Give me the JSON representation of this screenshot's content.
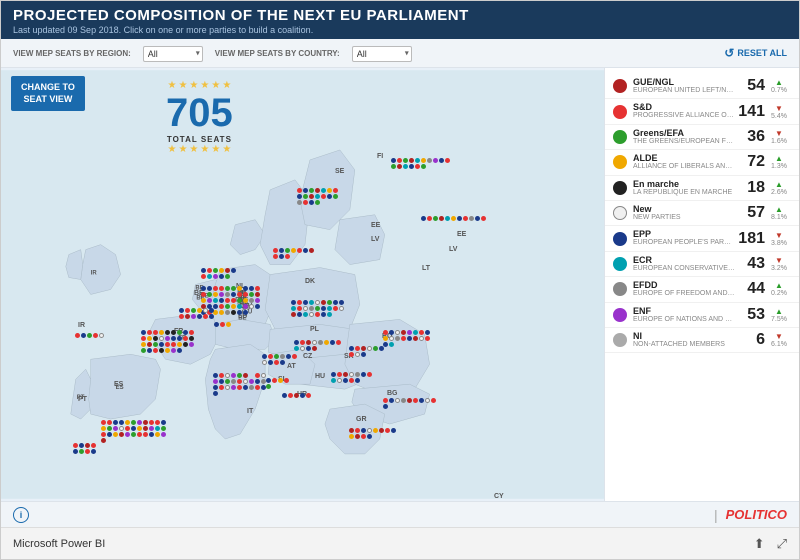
{
  "header": {
    "title": "PROJECTED COMPOSITION OF THE NEXT EU PARLIAMENT",
    "subtitle": "Last updated 09 Sep 2018. Click on one or more parties to build a coalition."
  },
  "toolbar": {
    "region_label": "VIEW MEP SEATS BY REGION:",
    "country_label": "VIEW MEP SEATS BY COUNTRY:",
    "region_value": "All",
    "country_value": "All",
    "reset_label": "RESET ALL"
  },
  "map": {
    "change_to_seat_view_line1": "CHANGE TO",
    "change_to_seat_view_line2": "SEAT VIEW",
    "total_seats_number": "705",
    "total_seats_label": "TOTAL SEATS"
  },
  "parties": [
    {
      "id": "GUE_NGL",
      "name": "GUE/NGL",
      "fullname": "EUROPEAN UNITED LEFT/NORDIC GREEN LEFT",
      "seats": 54,
      "pct": "0.7%",
      "trend": "up",
      "color": "#b22222"
    },
    {
      "id": "SD",
      "name": "S&D",
      "fullname": "PROGRESSIVE ALLIANCE OF SOCIALISTS AND DEMOCRATS",
      "seats": 141,
      "pct": "5.4%",
      "trend": "down",
      "color": "#e63232"
    },
    {
      "id": "Greens_EFA",
      "name": "Greens/EFA",
      "fullname": "THE GREENS/EUROPEAN FREE ALLIANCE",
      "seats": 36,
      "pct": "1.6%",
      "trend": "down",
      "color": "#2d9e2d"
    },
    {
      "id": "ALDE",
      "name": "ALDE",
      "fullname": "ALLIANCE OF LIBERALS AND DEMOCRATS FOR EUROPE",
      "seats": 72,
      "pct": "1.3%",
      "trend": "up",
      "color": "#f0a800"
    },
    {
      "id": "En_marche",
      "name": "En marche",
      "fullname": "LA REPUBLIQUE EN MARCHE",
      "seats": 18,
      "pct": "2.6%",
      "trend": "up",
      "color": "#222222"
    },
    {
      "id": "New",
      "name": "New",
      "fullname": "NEW PARTIES",
      "seats": 57,
      "pct": "8.1%",
      "trend": "up",
      "color": "#f0f0f0",
      "border": "#888"
    },
    {
      "id": "EPP",
      "name": "EPP",
      "fullname": "EUROPEAN PEOPLE'S PARTY GROUP",
      "seats": 181,
      "pct": "3.8%",
      "trend": "down",
      "color": "#1a3a8a"
    },
    {
      "id": "ECR",
      "name": "ECR",
      "fullname": "EUROPEAN CONSERVATIVES AND REFORMISTS",
      "seats": 43,
      "pct": "3.2%",
      "trend": "down",
      "color": "#00a0b0"
    },
    {
      "id": "EFDD",
      "name": "EFDD",
      "fullname": "EUROPE OF FREEDOM AND DIRECT DEMOCRACY",
      "seats": 44,
      "pct": "0.2%",
      "trend": "up",
      "color": "#888888"
    },
    {
      "id": "ENF",
      "name": "ENF",
      "fullname": "EUROPE OF NATIONS AND FREEDOM",
      "seats": 53,
      "pct": "7.5%",
      "trend": "up",
      "color": "#9932cc"
    },
    {
      "id": "NI",
      "name": "NI",
      "fullname": "NON-ATTACHED MEMBERS",
      "seats": 6,
      "pct": "6.1%",
      "trend": "down",
      "color": "#aaaaaa"
    }
  ],
  "footer": {
    "info_icon": "i",
    "divider": "|",
    "politico": "POLITICO"
  },
  "powerbi": {
    "label": "Microsoft Power BI",
    "share_icon": "⬆",
    "expand_icon": "⤢"
  }
}
